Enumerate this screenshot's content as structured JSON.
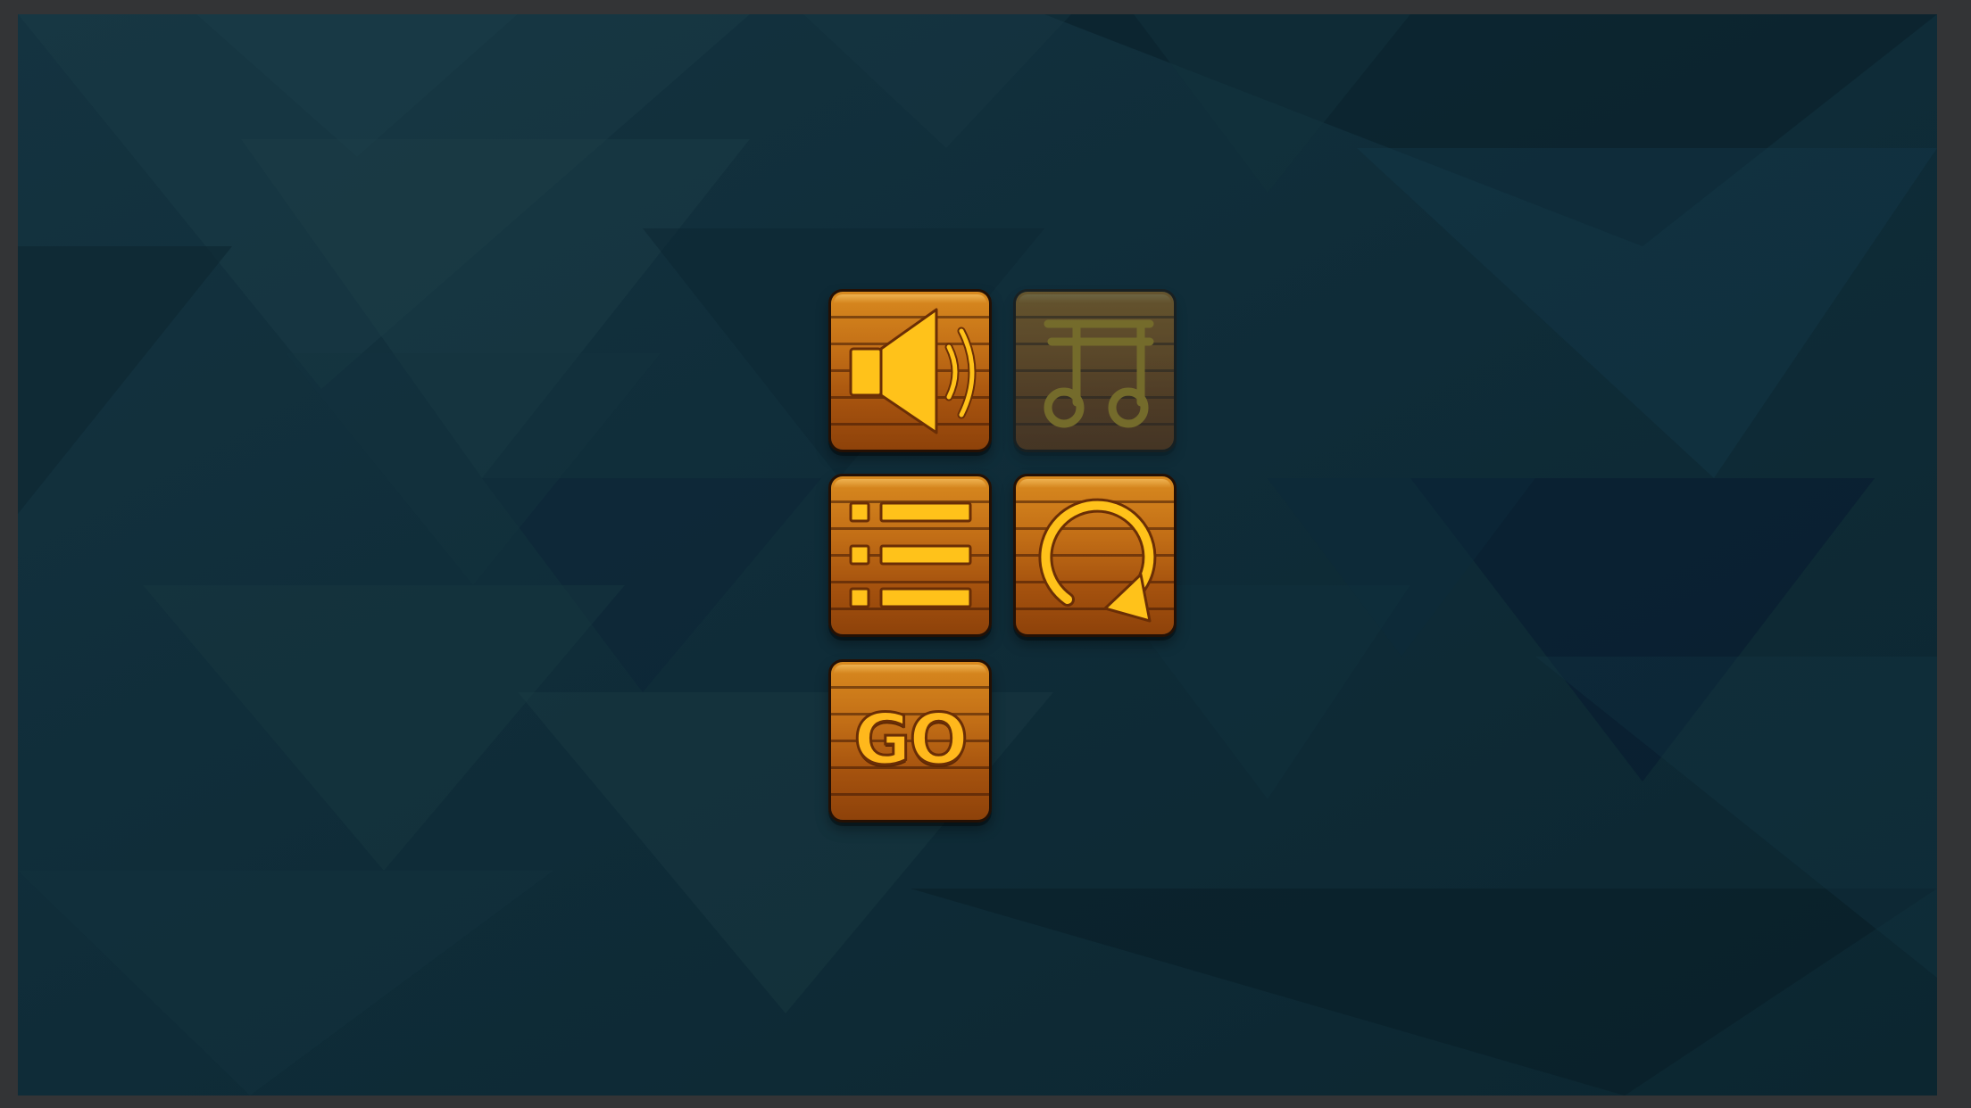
{
  "theme": {
    "background": "#0f2b37",
    "glyph_color": "#ffc21a",
    "wood_light": "#d98a1f",
    "wood_dark": "#8e420a"
  },
  "menu": {
    "buttons": [
      {
        "id": "sound",
        "icon": "speaker-icon",
        "state": "on"
      },
      {
        "id": "music",
        "icon": "music-note-icon",
        "state": "off"
      },
      {
        "id": "levels",
        "icon": "list-icon"
      },
      {
        "id": "restart",
        "icon": "restart-icon"
      },
      {
        "id": "go",
        "icon": "go-text",
        "label": "GO"
      }
    ]
  }
}
